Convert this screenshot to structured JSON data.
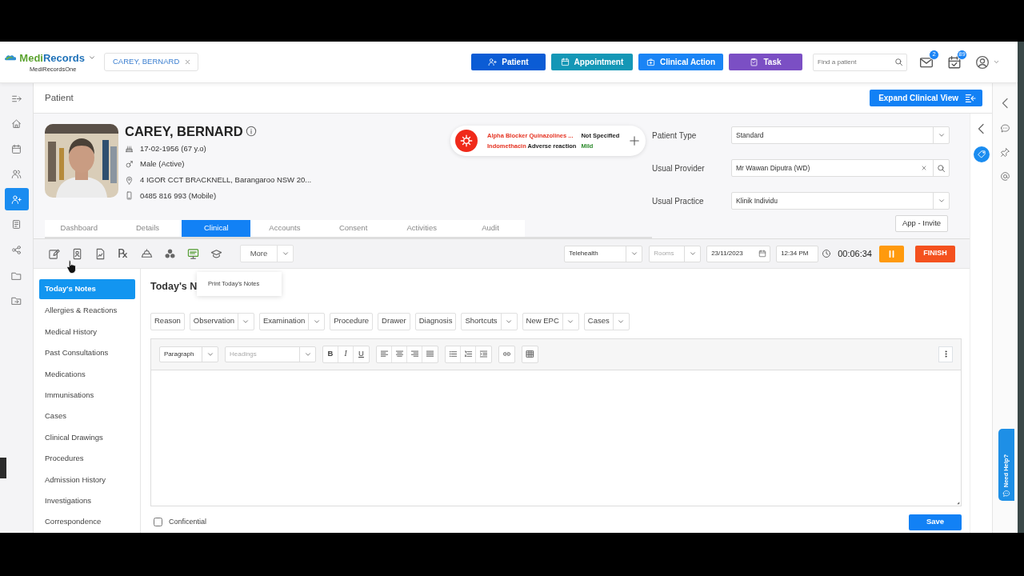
{
  "app": {
    "name": "MediRecords",
    "subtitle": "MediRecordsOne"
  },
  "open_patient": {
    "label": "CAREY, BERNARD"
  },
  "header_buttons": [
    {
      "label": "Patient",
      "kind": "person-plus",
      "color": "#0b5cd5"
    },
    {
      "label": "Appointment",
      "kind": "calendar",
      "color": "#1497b6"
    },
    {
      "label": "Clinical Action",
      "kind": "medkit",
      "color": "#1a84f5"
    },
    {
      "label": "Task",
      "kind": "clipboard",
      "color": "#7b4fc4"
    }
  ],
  "search": {
    "placeholder": "Find a patient"
  },
  "notifications": [
    {
      "kind": "mail",
      "count": "2"
    },
    {
      "kind": "cal-check",
      "count": "89"
    }
  ],
  "left_rail": [
    {
      "kind": "collapse",
      "selected": false
    },
    {
      "kind": "home",
      "selected": false
    },
    {
      "kind": "calendar",
      "selected": false
    },
    {
      "kind": "users",
      "selected": false
    },
    {
      "kind": "person-plus",
      "selected": true
    },
    {
      "kind": "report",
      "selected": false
    },
    {
      "kind": "share",
      "selected": false
    },
    {
      "kind": "folder",
      "selected": false
    },
    {
      "kind": "folder-out",
      "selected": false
    }
  ],
  "page_title": "Patient",
  "expand_button": "Expand Clinical View",
  "patient": {
    "name": "CAREY, BERNARD",
    "details": [
      {
        "kind": "cake",
        "text": "17-02-1956 (67 y.o)"
      },
      {
        "kind": "gender",
        "text": "Male (Active)"
      },
      {
        "kind": "pin",
        "text": "4 IGOR CCT BRACKNELL, Barangaroo NSW 20..."
      },
      {
        "kind": "phone",
        "text": "0485 816 993 (Mobile)"
      }
    ]
  },
  "allergies": [
    {
      "name": "Alpha Blocker Quinazolines ...",
      "severity": "Not Specified",
      "color": "#222222"
    },
    {
      "name": "Indomethacin",
      "reaction": "Adverse reaction",
      "severity": "Mild",
      "color": "#2e8b2e"
    }
  ],
  "fields": [
    {
      "label": "Patient Type",
      "value": "Standard",
      "kind": "select"
    },
    {
      "label": "Usual Provider",
      "value": "Mr Wawan Diputra (WD)",
      "kind": "search"
    },
    {
      "label": "Usual Practice",
      "value": "Klinik Individu",
      "kind": "select"
    }
  ],
  "app_invite": "App - Invite",
  "tabs": [
    {
      "label": "Dashboard",
      "selected": false
    },
    {
      "label": "Details",
      "selected": false
    },
    {
      "label": "Clinical",
      "selected": true
    },
    {
      "label": "Accounts",
      "selected": false
    },
    {
      "label": "Consent",
      "selected": false
    },
    {
      "label": "Activities",
      "selected": false
    },
    {
      "label": "Audit",
      "selected": false
    }
  ],
  "toolbar": {
    "icons": [
      {
        "kind": "note-edit"
      },
      {
        "kind": "id-card"
      },
      {
        "kind": "doc-chart"
      },
      {
        "kind": "rx",
        "glyph": "℞"
      },
      {
        "kind": "scale"
      },
      {
        "kind": "biohazard"
      },
      {
        "kind": "monitor"
      },
      {
        "kind": "graduation"
      }
    ],
    "more": "More",
    "menu": [
      "Print Today's Notes"
    ],
    "mode": "Telehealth",
    "rooms_placeholder": "Rooms",
    "date": "23/11/2023",
    "time": "12:34 PM",
    "timer": "00:06:34",
    "finish": "FINISH"
  },
  "nav": [
    {
      "label": "Today's Notes",
      "selected": true
    },
    {
      "label": "Allergies & Reactions",
      "selected": false
    },
    {
      "label": "Medical History",
      "selected": false
    },
    {
      "label": "Past Consultations",
      "selected": false
    },
    {
      "label": "Medications",
      "selected": false
    },
    {
      "label": "Immunisations",
      "selected": false
    },
    {
      "label": "Cases",
      "selected": false
    },
    {
      "label": "Clinical Drawings",
      "selected": false
    },
    {
      "label": "Procedures",
      "selected": false
    },
    {
      "label": "Admission History",
      "selected": false
    },
    {
      "label": "Investigations",
      "selected": false
    },
    {
      "label": "Correspondence",
      "selected": false
    }
  ],
  "notes_title": "Today's N",
  "note_buttons": [
    {
      "label": "Reason",
      "has_menu": false
    },
    {
      "label": "Observation",
      "has_menu": true
    },
    {
      "label": "Examination",
      "has_menu": true
    },
    {
      "label": "Procedure",
      "has_menu": false
    },
    {
      "label": "Drawer",
      "has_menu": false
    },
    {
      "label": "Diagnosis",
      "has_menu": false
    },
    {
      "label": "Shortcuts",
      "has_menu": true
    },
    {
      "label": "New EPC",
      "has_menu": true
    },
    {
      "label": "Cases",
      "has_menu": true
    }
  ],
  "editor": {
    "format": "Paragraph",
    "headings_placeholder": "Headings",
    "tool_groups": [
      [
        {
          "kind": "bold",
          "text": "B"
        },
        {
          "kind": "italic",
          "text": "I"
        },
        {
          "kind": "underline",
          "text": "U"
        }
      ],
      [
        {
          "kind": "align-left"
        },
        {
          "kind": "align-center"
        },
        {
          "kind": "align-right"
        },
        {
          "kind": "justify"
        }
      ],
      [
        {
          "kind": "bullets"
        },
        {
          "kind": "numbers"
        },
        {
          "kind": "indent"
        }
      ],
      [
        {
          "kind": "link"
        }
      ],
      [
        {
          "kind": "table"
        }
      ]
    ]
  },
  "confidential": {
    "label": "Conficential",
    "checked": false
  },
  "save": "Save",
  "need_help": "Need Help?"
}
